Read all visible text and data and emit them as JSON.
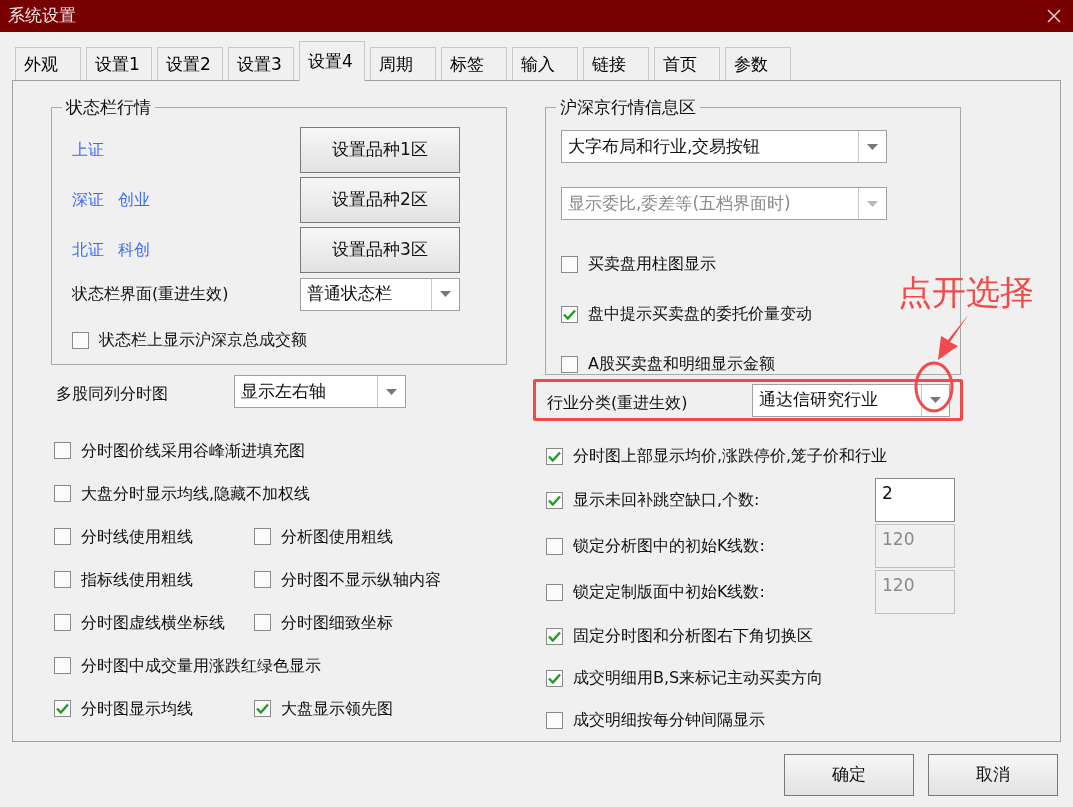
{
  "window": {
    "title": "系统设置"
  },
  "tabs": [
    {
      "label": "外观",
      "selected": false
    },
    {
      "label": "设置1",
      "selected": false
    },
    {
      "label": "设置2",
      "selected": false
    },
    {
      "label": "设置3",
      "selected": false
    },
    {
      "label": "设置4",
      "selected": true
    },
    {
      "label": "周期",
      "selected": false
    },
    {
      "label": "标签",
      "selected": false
    },
    {
      "label": "输入",
      "selected": false
    },
    {
      "label": "链接",
      "selected": false
    },
    {
      "label": "首页",
      "selected": false
    },
    {
      "label": "参数",
      "selected": false
    }
  ],
  "status_group": {
    "title": "状态栏行情",
    "rows": [
      {
        "labels": [
          "上证"
        ],
        "button": "设置品种1区"
      },
      {
        "labels": [
          "深证",
          "创业"
        ],
        "button": "设置品种2区"
      },
      {
        "labels": [
          "北证",
          "科创"
        ],
        "button": "设置品种3区"
      }
    ],
    "interface": {
      "label": "状态栏界面(重进生效)",
      "value": "普通状态栏"
    },
    "checkbox": {
      "label": "状态栏上显示沪深京总成交额",
      "checked": false
    }
  },
  "multi_stock": {
    "label": "多股同列分时图",
    "value": "显示左右轴"
  },
  "left_options": [
    {
      "items": [
        {
          "label": "分时图价线采用谷峰渐进填充图",
          "checked": false
        }
      ]
    },
    {
      "items": [
        {
          "label": "大盘分时显示均线,隐藏不加权线",
          "checked": false
        }
      ]
    },
    {
      "items": [
        {
          "label": "分时线使用粗线",
          "checked": false
        },
        {
          "label": "分析图使用粗线",
          "checked": false
        }
      ]
    },
    {
      "items": [
        {
          "label": "指标线使用粗线",
          "checked": false
        },
        {
          "label": "分时图不显示纵轴内容",
          "checked": false
        }
      ]
    },
    {
      "items": [
        {
          "label": "分时图虚线横坐标线",
          "checked": false
        },
        {
          "label": "分时图细致坐标",
          "checked": false
        }
      ]
    },
    {
      "items": [
        {
          "label": "分时图中成交量用涨跌红绿色显示",
          "checked": false
        }
      ]
    },
    {
      "items": [
        {
          "label": "分时图显示均线",
          "checked": true
        },
        {
          "label": "大盘显示领先图",
          "checked": true
        }
      ]
    }
  ],
  "info_group": {
    "title": "沪深京行情信息区",
    "dropdowns": [
      {
        "value": "大字布局和行业,交易按钮",
        "disabled": false
      },
      {
        "value": "显示委比,委差等(五档界面时)",
        "disabled": true
      }
    ],
    "checkboxes": [
      {
        "label": "买卖盘用柱图显示",
        "checked": false
      },
      {
        "label": "盘中提示买卖盘的委托价量变动",
        "checked": true
      },
      {
        "label": "A股买卖盘和明细显示金额",
        "checked": false
      }
    ]
  },
  "industry": {
    "label": "行业分类(重进生效)",
    "value": "通达信研究行业"
  },
  "right_options": [
    {
      "kind": "plain",
      "label": "分时图上部显示均价,涨跌停价,笼子价和行业",
      "checked": true
    },
    {
      "kind": "count",
      "label": "显示未回补跳空缺口,个数:",
      "checked": true,
      "value": "2",
      "disabled": false
    },
    {
      "kind": "count",
      "label": "锁定分析图中的初始K线数:",
      "checked": false,
      "value": "120",
      "disabled": true
    },
    {
      "kind": "count",
      "label": "锁定定制版面中初始K线数:",
      "checked": false,
      "value": "120",
      "disabled": true
    },
    {
      "kind": "plain",
      "label": "固定分时图和分析图右下角切换区",
      "checked": true
    },
    {
      "kind": "plain",
      "label": "成交明细用B,S来标记主动买卖方向",
      "checked": true
    },
    {
      "kind": "plain",
      "label": "成交明细按每分钟间隔显示",
      "checked": false
    }
  ],
  "annotation": {
    "text": "点开选择"
  },
  "buttons": [
    "确定",
    "取消"
  ]
}
